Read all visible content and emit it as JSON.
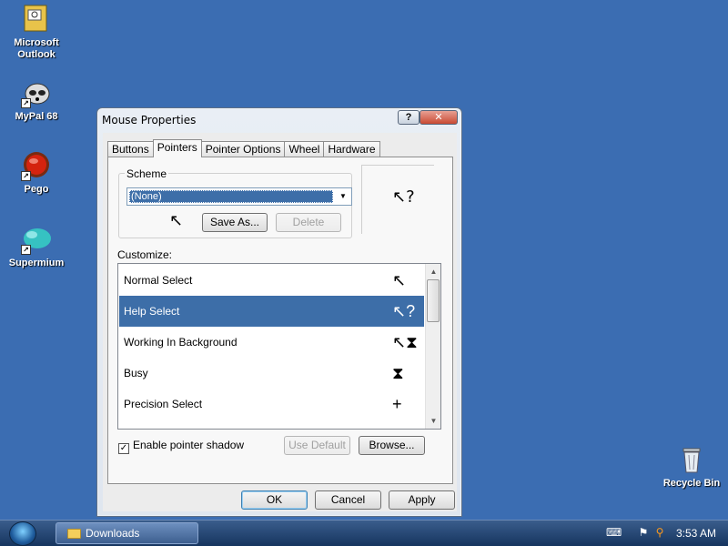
{
  "desktop": {
    "icons": [
      {
        "label_line1": "Microsoft",
        "label_line2": "Outlook",
        "icon": "outlook-icon"
      },
      {
        "label_line1": "MyPal 68",
        "label_line2": "",
        "icon": "raccoon-icon"
      },
      {
        "label_line1": "Pego",
        "label_line2": "",
        "icon": "red-orb-icon"
      },
      {
        "label_line1": "Supermium",
        "label_line2": "",
        "icon": "cloud-browser-icon"
      },
      {
        "label_line1": "Recycle Bin",
        "label_line2": "",
        "icon": "recycle-bin-icon"
      }
    ]
  },
  "dialog": {
    "title": "Mouse Properties",
    "help_glyph": "?",
    "close_glyph": "✕",
    "tabs": [
      "Buttons",
      "Pointers",
      "Pointer Options",
      "Wheel",
      "Hardware"
    ],
    "active_tab": "Pointers",
    "scheme": {
      "group_label": "Scheme",
      "selected": "(None)",
      "save_as": "Save As...",
      "delete": "Delete"
    },
    "customize_label": "Customize:",
    "pointers": [
      {
        "name": "Normal Select",
        "cursor": "arrow-cursor-icon",
        "glyph": "↖"
      },
      {
        "name": "Help Select",
        "cursor": "help-cursor-icon",
        "glyph": "↖?"
      },
      {
        "name": "Working In Background",
        "cursor": "working-cursor-icon",
        "glyph": "↖⧗"
      },
      {
        "name": "Busy",
        "cursor": "hourglass-cursor-icon",
        "glyph": "⧗"
      },
      {
        "name": "Precision Select",
        "cursor": "crosshair-cursor-icon",
        "glyph": "+"
      }
    ],
    "selected_pointer": "Help Select",
    "preview_glyph": "↖?",
    "enable_shadow_label": "Enable pointer shadow",
    "enable_shadow_checked": true,
    "use_default": "Use Default",
    "browse": "Browse...",
    "ok": "OK",
    "cancel": "Cancel",
    "apply": "Apply"
  },
  "taskbar": {
    "task_label": "Downloads",
    "clock": "3:53 AM"
  }
}
